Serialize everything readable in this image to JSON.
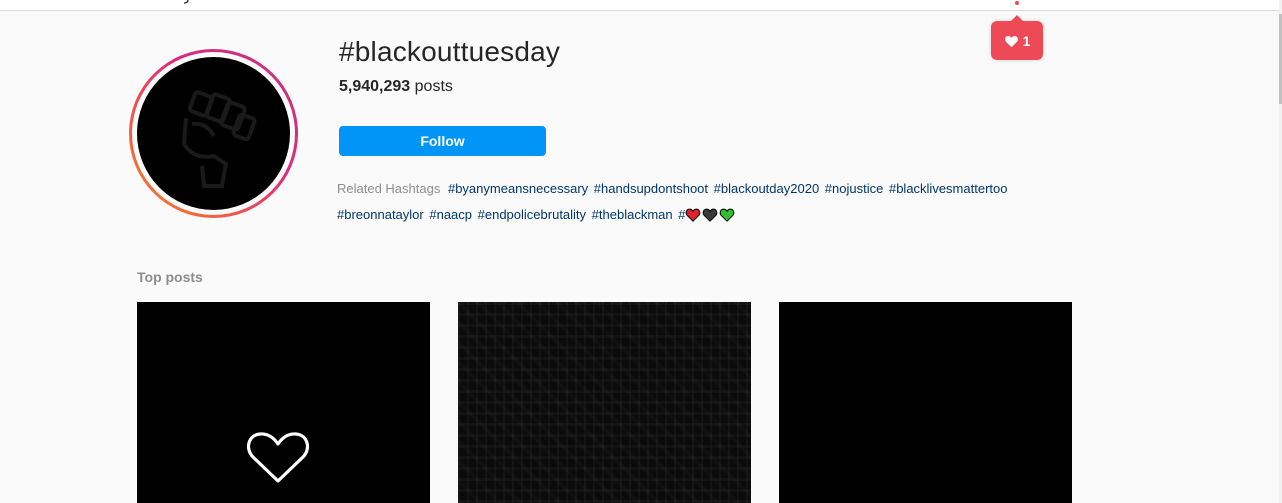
{
  "activity": {
    "like_count": "1",
    "icon": "heart-icon",
    "color": "#ed4956"
  },
  "hashtag": {
    "title": "#blackouttuesday",
    "post_count": "5,940,293",
    "post_count_suffix": "posts",
    "follow_label": "Follow",
    "accent": "#0095f6"
  },
  "related": {
    "label": "Related Hashtags",
    "tags": [
      "#byanymeansnecessary",
      "#handsupdontshoot",
      "#blackoutday2020",
      "#nojustice",
      "#blacklivesmattertoo",
      "#breonnataylor",
      "#naacp",
      "#endpolicebrutality",
      "#theblackman",
      "#"
    ],
    "last_tag_emojis": [
      "red-heart",
      "black-heart",
      "green-heart"
    ],
    "link_color": "#00376b"
  },
  "top_posts": {
    "title": "Top posts",
    "posts": [
      {
        "icon": "heart-outline-icon"
      },
      {
        "icon": ""
      },
      {
        "icon": ""
      }
    ]
  }
}
